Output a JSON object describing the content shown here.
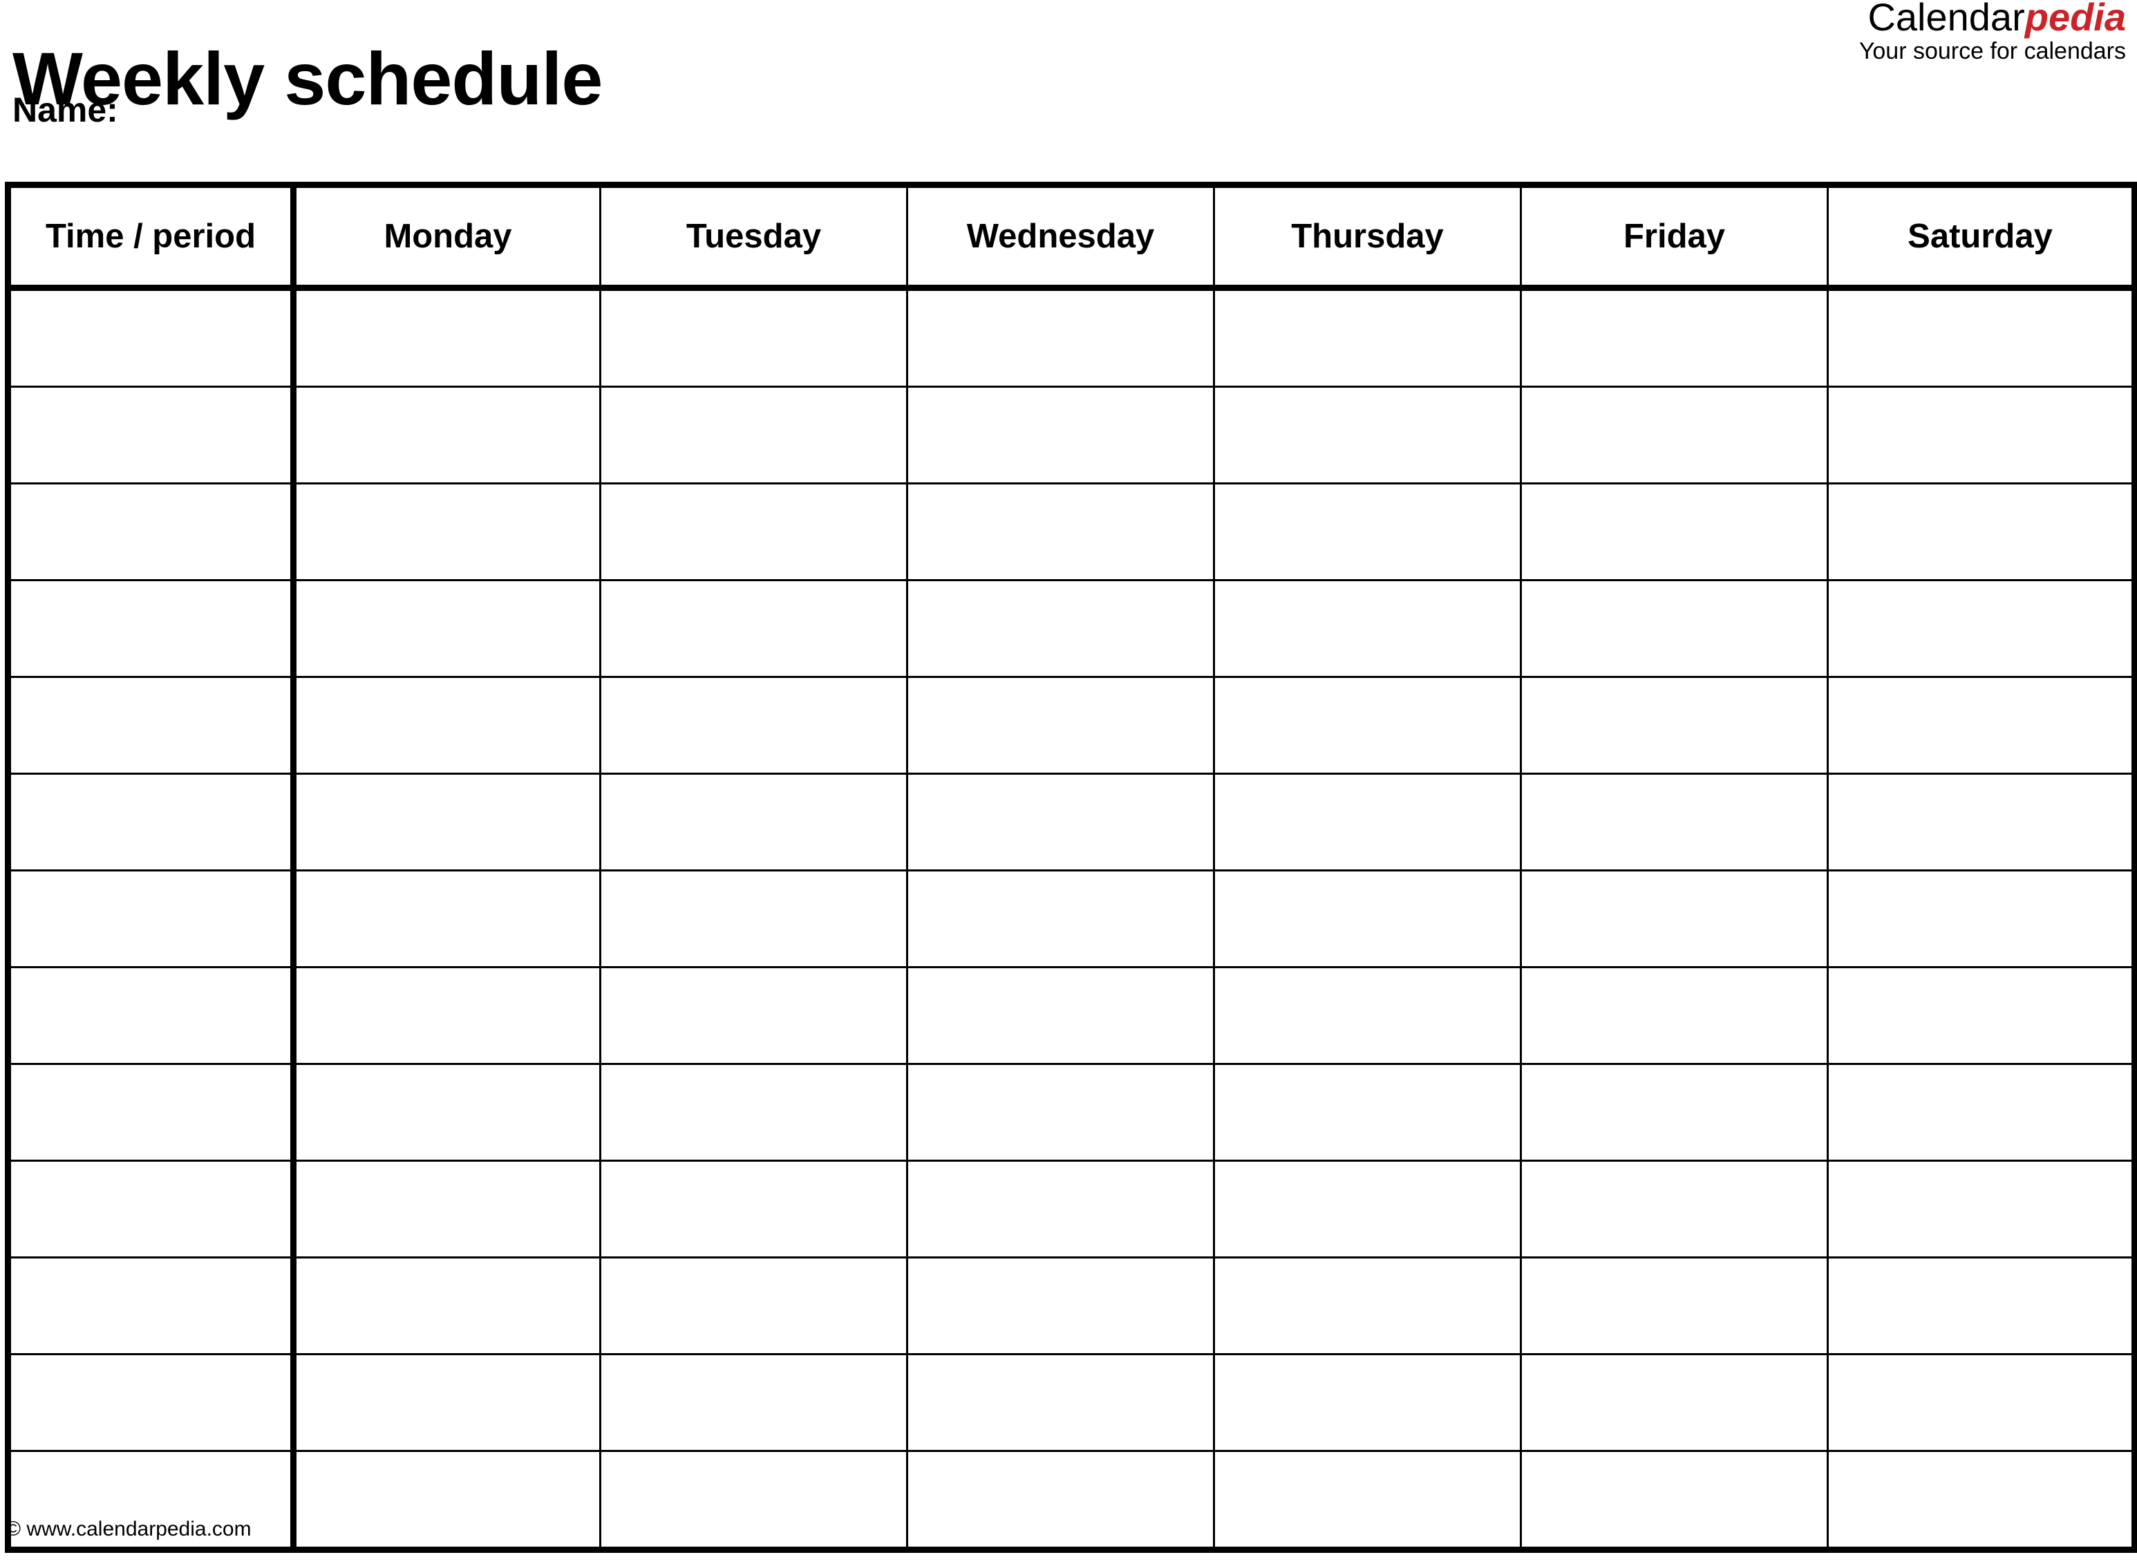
{
  "document": {
    "title": "Weekly schedule",
    "name_label": "Name:"
  },
  "brand": {
    "name_part_a": "Calendar",
    "name_part_b": "pedia",
    "tagline": "Your source for calendars",
    "accent_color": "#CC2229"
  },
  "table": {
    "columns": [
      "Time / period",
      "Monday",
      "Tuesday",
      "Wednesday",
      "Thursday",
      "Friday",
      "Saturday"
    ],
    "row_count": 13,
    "rows": [
      [
        "",
        "",
        "",
        "",
        "",
        "",
        ""
      ],
      [
        "",
        "",
        "",
        "",
        "",
        "",
        ""
      ],
      [
        "",
        "",
        "",
        "",
        "",
        "",
        ""
      ],
      [
        "",
        "",
        "",
        "",
        "",
        "",
        ""
      ],
      [
        "",
        "",
        "",
        "",
        "",
        "",
        ""
      ],
      [
        "",
        "",
        "",
        "",
        "",
        "",
        ""
      ],
      [
        "",
        "",
        "",
        "",
        "",
        "",
        ""
      ],
      [
        "",
        "",
        "",
        "",
        "",
        "",
        ""
      ],
      [
        "",
        "",
        "",
        "",
        "",
        "",
        ""
      ],
      [
        "",
        "",
        "",
        "",
        "",
        "",
        ""
      ],
      [
        "",
        "",
        "",
        "",
        "",
        "",
        ""
      ],
      [
        "",
        "",
        "",
        "",
        "",
        "",
        ""
      ],
      [
        "",
        "",
        "",
        "",
        "",
        "",
        ""
      ]
    ]
  },
  "footer": {
    "credit": "© www.calendarpedia.com"
  }
}
